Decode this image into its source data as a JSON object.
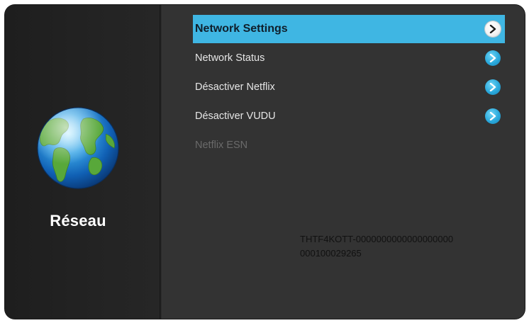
{
  "left_panel": {
    "title": "Réseau",
    "icon": "globe-icon"
  },
  "menu": {
    "items": [
      {
        "label": "Network Settings",
        "selected": true,
        "has_arrow": true
      },
      {
        "label": "Network Status",
        "selected": false,
        "has_arrow": true
      },
      {
        "label": "Désactiver Netflix",
        "selected": false,
        "has_arrow": true
      },
      {
        "label": "Désactiver VUDU",
        "selected": false,
        "has_arrow": true
      },
      {
        "label": "Netflix ESN",
        "selected": false,
        "has_arrow": false,
        "disabled": true
      }
    ]
  },
  "esn": {
    "line1": "THTF4KOTT-0000000000000000000",
    "line2": "000100029265"
  },
  "colors": {
    "highlight": "#3fb6e3",
    "arrow": "#29a9dc",
    "panel_dark": "#222222",
    "panel": "#333333"
  }
}
